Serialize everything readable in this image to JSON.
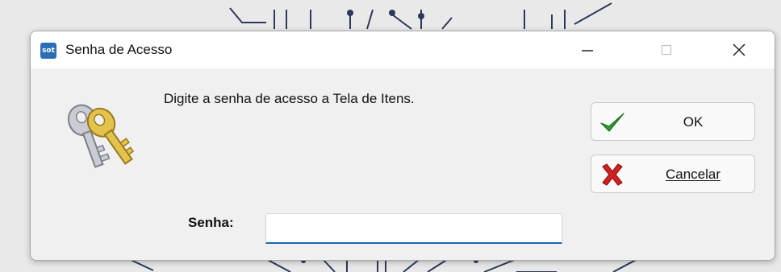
{
  "window": {
    "title": "Senha de Acesso",
    "app_icon_text": "sot"
  },
  "dialog": {
    "prompt": "Digite a senha de acesso a Tela de Itens.",
    "ok_label": "OK",
    "cancel_label": "Cancelar",
    "password_label": "Senha:",
    "password_value": ""
  },
  "icons": {
    "ok": "green-checkmark-icon",
    "cancel": "red-x-icon",
    "keys": "keys-icon"
  },
  "colors": {
    "input_focus": "#1e64b4",
    "ok_green": "#2e9e2e",
    "cancel_red": "#d42020",
    "key_gold": "#d8b640"
  }
}
